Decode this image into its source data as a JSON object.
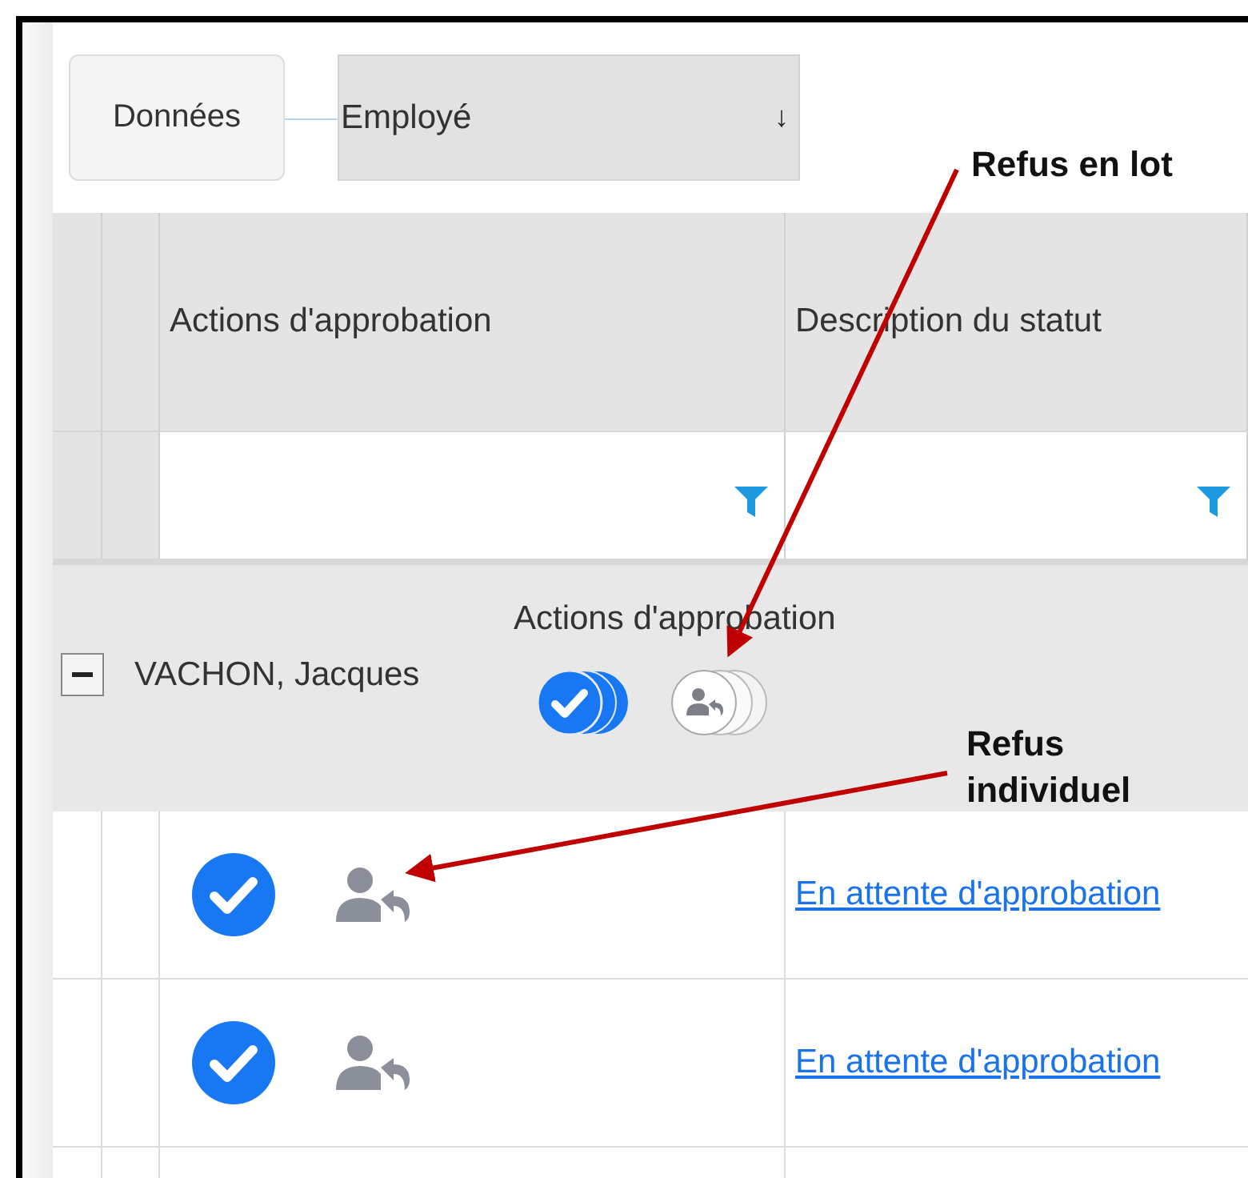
{
  "toolbar": {
    "data_button": "Données",
    "group_field": {
      "value": "Employé",
      "sort_glyph": "↓"
    }
  },
  "columns": [
    {
      "label": "Actions d'approbation"
    },
    {
      "label": "Description du statut"
    }
  ],
  "group": {
    "name": "VACHON, Jacques",
    "expanded": true,
    "actions_label": "Actions d'approbation"
  },
  "rows": [
    {
      "status": "En attente d'approbation"
    },
    {
      "status": "En attente d'approbation"
    }
  ],
  "annotations": [
    {
      "text": "Refus en lot"
    },
    {
      "text": "Refus individuel"
    }
  ]
}
